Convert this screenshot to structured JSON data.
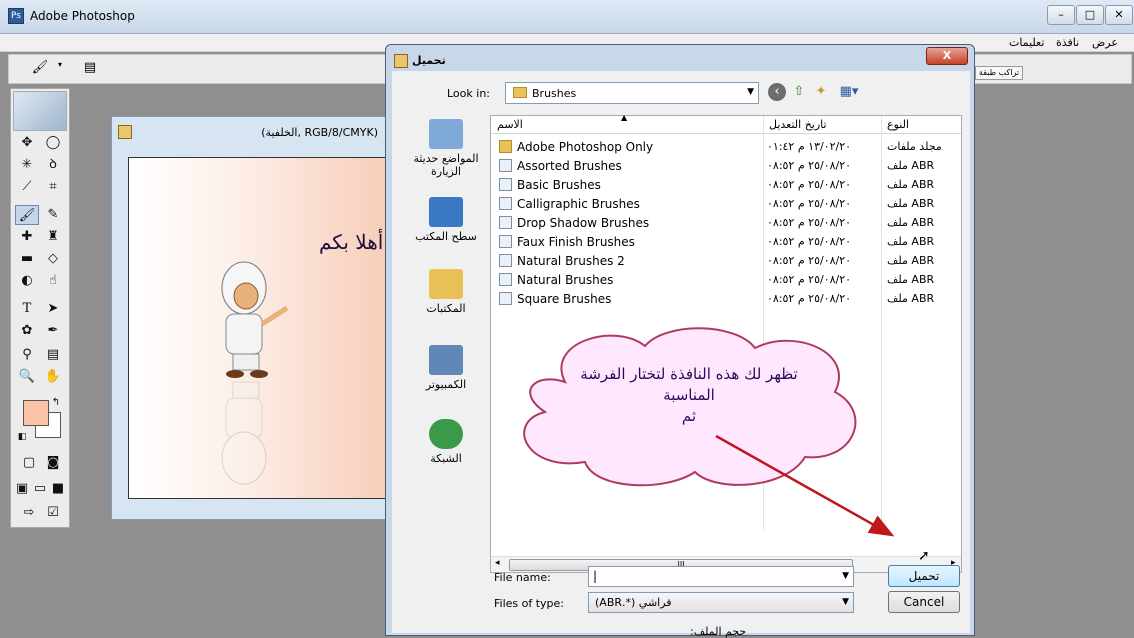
{
  "photoshop": {
    "title": "Adobe Photoshop",
    "menus": [
      "عرض",
      "نافذة",
      "تعليمات"
    ],
    "palette_tab": "تراكب طبقة"
  },
  "document": {
    "title": "(RGB/8/CMYK ,الخلفية)",
    "greeting": "أهلا بكم"
  },
  "dialog": {
    "title": "تحميل",
    "close_label": "X",
    "look_in_label": "Look in:",
    "look_in_value": "Brushes",
    "columns": {
      "name": "الاسم",
      "date": "تاريخ التعديل",
      "type": "النوع"
    },
    "files": [
      {
        "name": "Adobe Photoshop Only",
        "date": "١٣/٠٢/٢٠ م ٠١:٤٢",
        "type": "مجلد ملفات",
        "folder": true
      },
      {
        "name": "Assorted Brushes",
        "date": "٢٥/٠٨/٢٠ م ٠٨:٥٢",
        "type": "ملف ABR"
      },
      {
        "name": "Basic Brushes",
        "date": "٢٥/٠٨/٢٠ م ٠٨:٥٢",
        "type": "ملف ABR"
      },
      {
        "name": "Calligraphic Brushes",
        "date": "٢٥/٠٨/٢٠ م ٠٨:٥٢",
        "type": "ملف ABR"
      },
      {
        "name": "Drop Shadow Brushes",
        "date": "٢٥/٠٨/٢٠ م ٠٨:٥٢",
        "type": "ملف ABR"
      },
      {
        "name": "Faux Finish Brushes",
        "date": "٢٥/٠٨/٢٠ م ٠٨:٥٢",
        "type": "ملف ABR"
      },
      {
        "name": "Natural Brushes 2",
        "date": "٢٥/٠٨/٢٠ م ٠٨:٥٢",
        "type": "ملف ABR"
      },
      {
        "name": "Natural Brushes",
        "date": "٢٥/٠٨/٢٠ م ٠٨:٥٢",
        "type": "ملف ABR"
      },
      {
        "name": "Square Brushes",
        "date": "٢٥/٠٨/٢٠ م ٠٨:٥٢",
        "type": "ملف ABR"
      }
    ],
    "places": [
      {
        "label": "المواضع حديثة الزيارة",
        "color": "#7fa9d8"
      },
      {
        "label": "سطح المكتب",
        "color": "#3b78c4"
      },
      {
        "label": "المكتبات",
        "color": "#e8c055"
      },
      {
        "label": "الكمبيوتر",
        "color": "#5f88b8"
      },
      {
        "label": "الشبكة",
        "color": "#3b9a4a"
      }
    ],
    "file_name_label": "File name:",
    "file_name_value": "",
    "file_type_label": "Files of type:",
    "file_type_value": "فراشي (*.ABR)",
    "file_size_label": "حجم الملف:",
    "load_button": "تحميل",
    "cancel_button": "Cancel",
    "scroll_grip": "III"
  },
  "callout": {
    "line1": "تظهر لك هذه النافذة لتختار الفرشة",
    "line2": "المناسبة",
    "line3": "ثم",
    "color": "#b03a5e"
  },
  "colors": {
    "foreground": "#fdc3a6",
    "background": "#ffffff"
  }
}
